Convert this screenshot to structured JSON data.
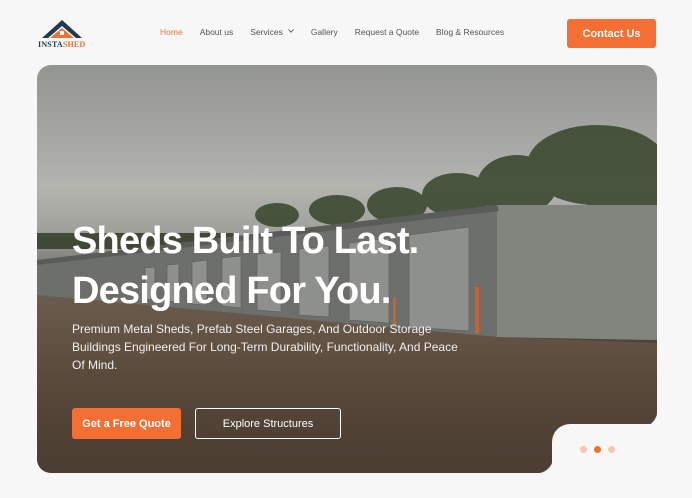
{
  "header": {
    "logo": {
      "part1": "INSTA",
      "part2": "SHED"
    },
    "nav": [
      {
        "label": "Home",
        "active": true
      },
      {
        "label": "About us",
        "active": false
      },
      {
        "label": "Services",
        "active": false,
        "has_dropdown": true
      },
      {
        "label": "Gallery",
        "active": false
      },
      {
        "label": "Request a Quote",
        "active": false
      },
      {
        "label": "Blog & Resources",
        "active": false
      }
    ],
    "contact_label": "Contact Us"
  },
  "hero": {
    "headline_line1": "Sheds Built To Last.",
    "headline_line2": "Designed For You.",
    "subtext": "Premium Metal Sheds, Prefab Steel Garages, And Outdoor Storage Buildings Engineered For Long-Term Durability, Functionality, And Peace Of Mind.",
    "primary_cta": "Get a Free Quote",
    "secondary_cta": "Explore Structures",
    "slides": {
      "count": 3,
      "active_index": 1
    }
  },
  "colors": {
    "accent": "#f46f33",
    "logo_dark": "#1f3b4d",
    "background": "#f7f7f7"
  }
}
